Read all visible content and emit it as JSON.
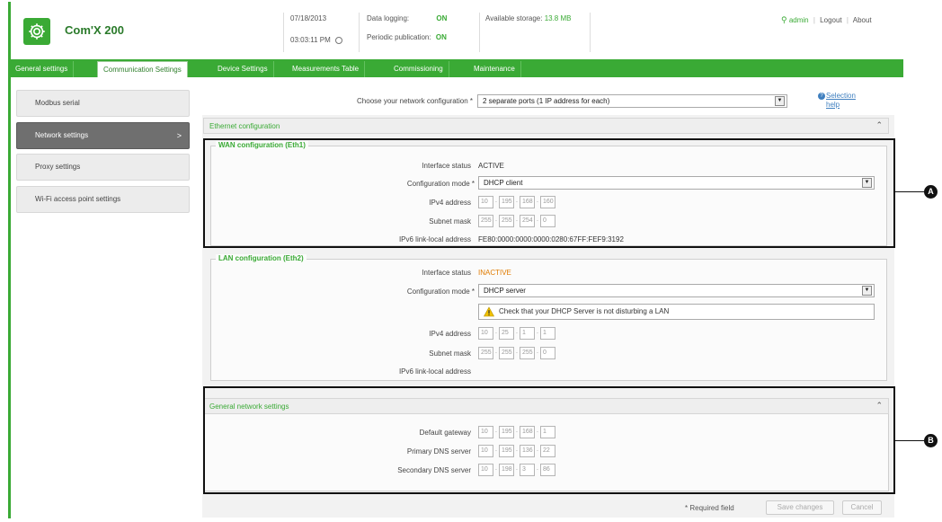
{
  "app": {
    "title": "Com'X 200",
    "date": "07/18/2013",
    "time": "03:03:11 PM",
    "data_logging_label": "Data logging:",
    "data_logging_value": "ON",
    "periodic_label": "Periodic publication:",
    "periodic_value": "ON",
    "storage_label": "Available storage:",
    "storage_value": "13.8 MB",
    "user": "admin",
    "logout": "Logout",
    "about": "About",
    "brand_color": "#3aaa35"
  },
  "tabs": [
    {
      "label": "General settings",
      "active": false
    },
    {
      "label": "Communication Settings",
      "active": true
    },
    {
      "label": "Device Settings",
      "active": false
    },
    {
      "label": "Measurements Table",
      "active": false
    },
    {
      "label": "Commissioning",
      "active": false
    },
    {
      "label": "Maintenance",
      "active": false
    }
  ],
  "sidebar": {
    "items": [
      {
        "label": "Modbus serial"
      },
      {
        "label": "Network settings",
        "chevron": ">"
      },
      {
        "label": "Proxy settings"
      },
      {
        "label": "Wi-Fi access point settings"
      }
    ]
  },
  "network": {
    "choose_label": "Choose your network configuration *",
    "choose_value": "2 separate ports (1 IP address for each)",
    "help_line1": "Selection",
    "help_line2": "help"
  },
  "ethernet": {
    "title": "Ethernet configuration",
    "wan": {
      "legend": "WAN configuration (Eth1)",
      "status_label": "Interface status",
      "status_value": "ACTIVE",
      "mode_label": "Configuration mode *",
      "mode_value": "DHCP client",
      "ipv4_label": "IPv4 address",
      "ipv4": [
        "10",
        "195",
        "168",
        "160"
      ],
      "subnet_label": "Subnet mask",
      "subnet": [
        "255",
        "255",
        "254",
        "0"
      ],
      "ipv6_label": "IPv6 link-local address",
      "ipv6_value": "FE80:0000:0000:0000:0280:67FF:FEF9:3192"
    },
    "lan": {
      "legend": "LAN configuration (Eth2)",
      "status_label": "Interface status",
      "status_value": "INACTIVE",
      "mode_label": "Configuration mode *",
      "mode_value": "DHCP server",
      "warning": "Check that your DHCP Server is not disturbing a LAN",
      "ipv4_label": "IPv4 address",
      "ipv4": [
        "10",
        "25",
        "1",
        "1"
      ],
      "subnet_label": "Subnet mask",
      "subnet": [
        "255",
        "255",
        "255",
        "0"
      ],
      "ipv6_label": "IPv6 link-local address"
    }
  },
  "general_network": {
    "title": "General network settings",
    "gateway_label": "Default gateway",
    "gateway": [
      "10",
      "195",
      "168",
      "1"
    ],
    "dns1_label": "Primary DNS server",
    "dns1": [
      "10",
      "195",
      "136",
      "22"
    ],
    "dns2_label": "Secondary DNS server",
    "dns2": [
      "10",
      "198",
      "3",
      "86"
    ]
  },
  "footer": {
    "required": "* Required field",
    "save": "Save changes",
    "cancel": "Cancel"
  },
  "callouts": {
    "a": "A",
    "b": "B"
  }
}
